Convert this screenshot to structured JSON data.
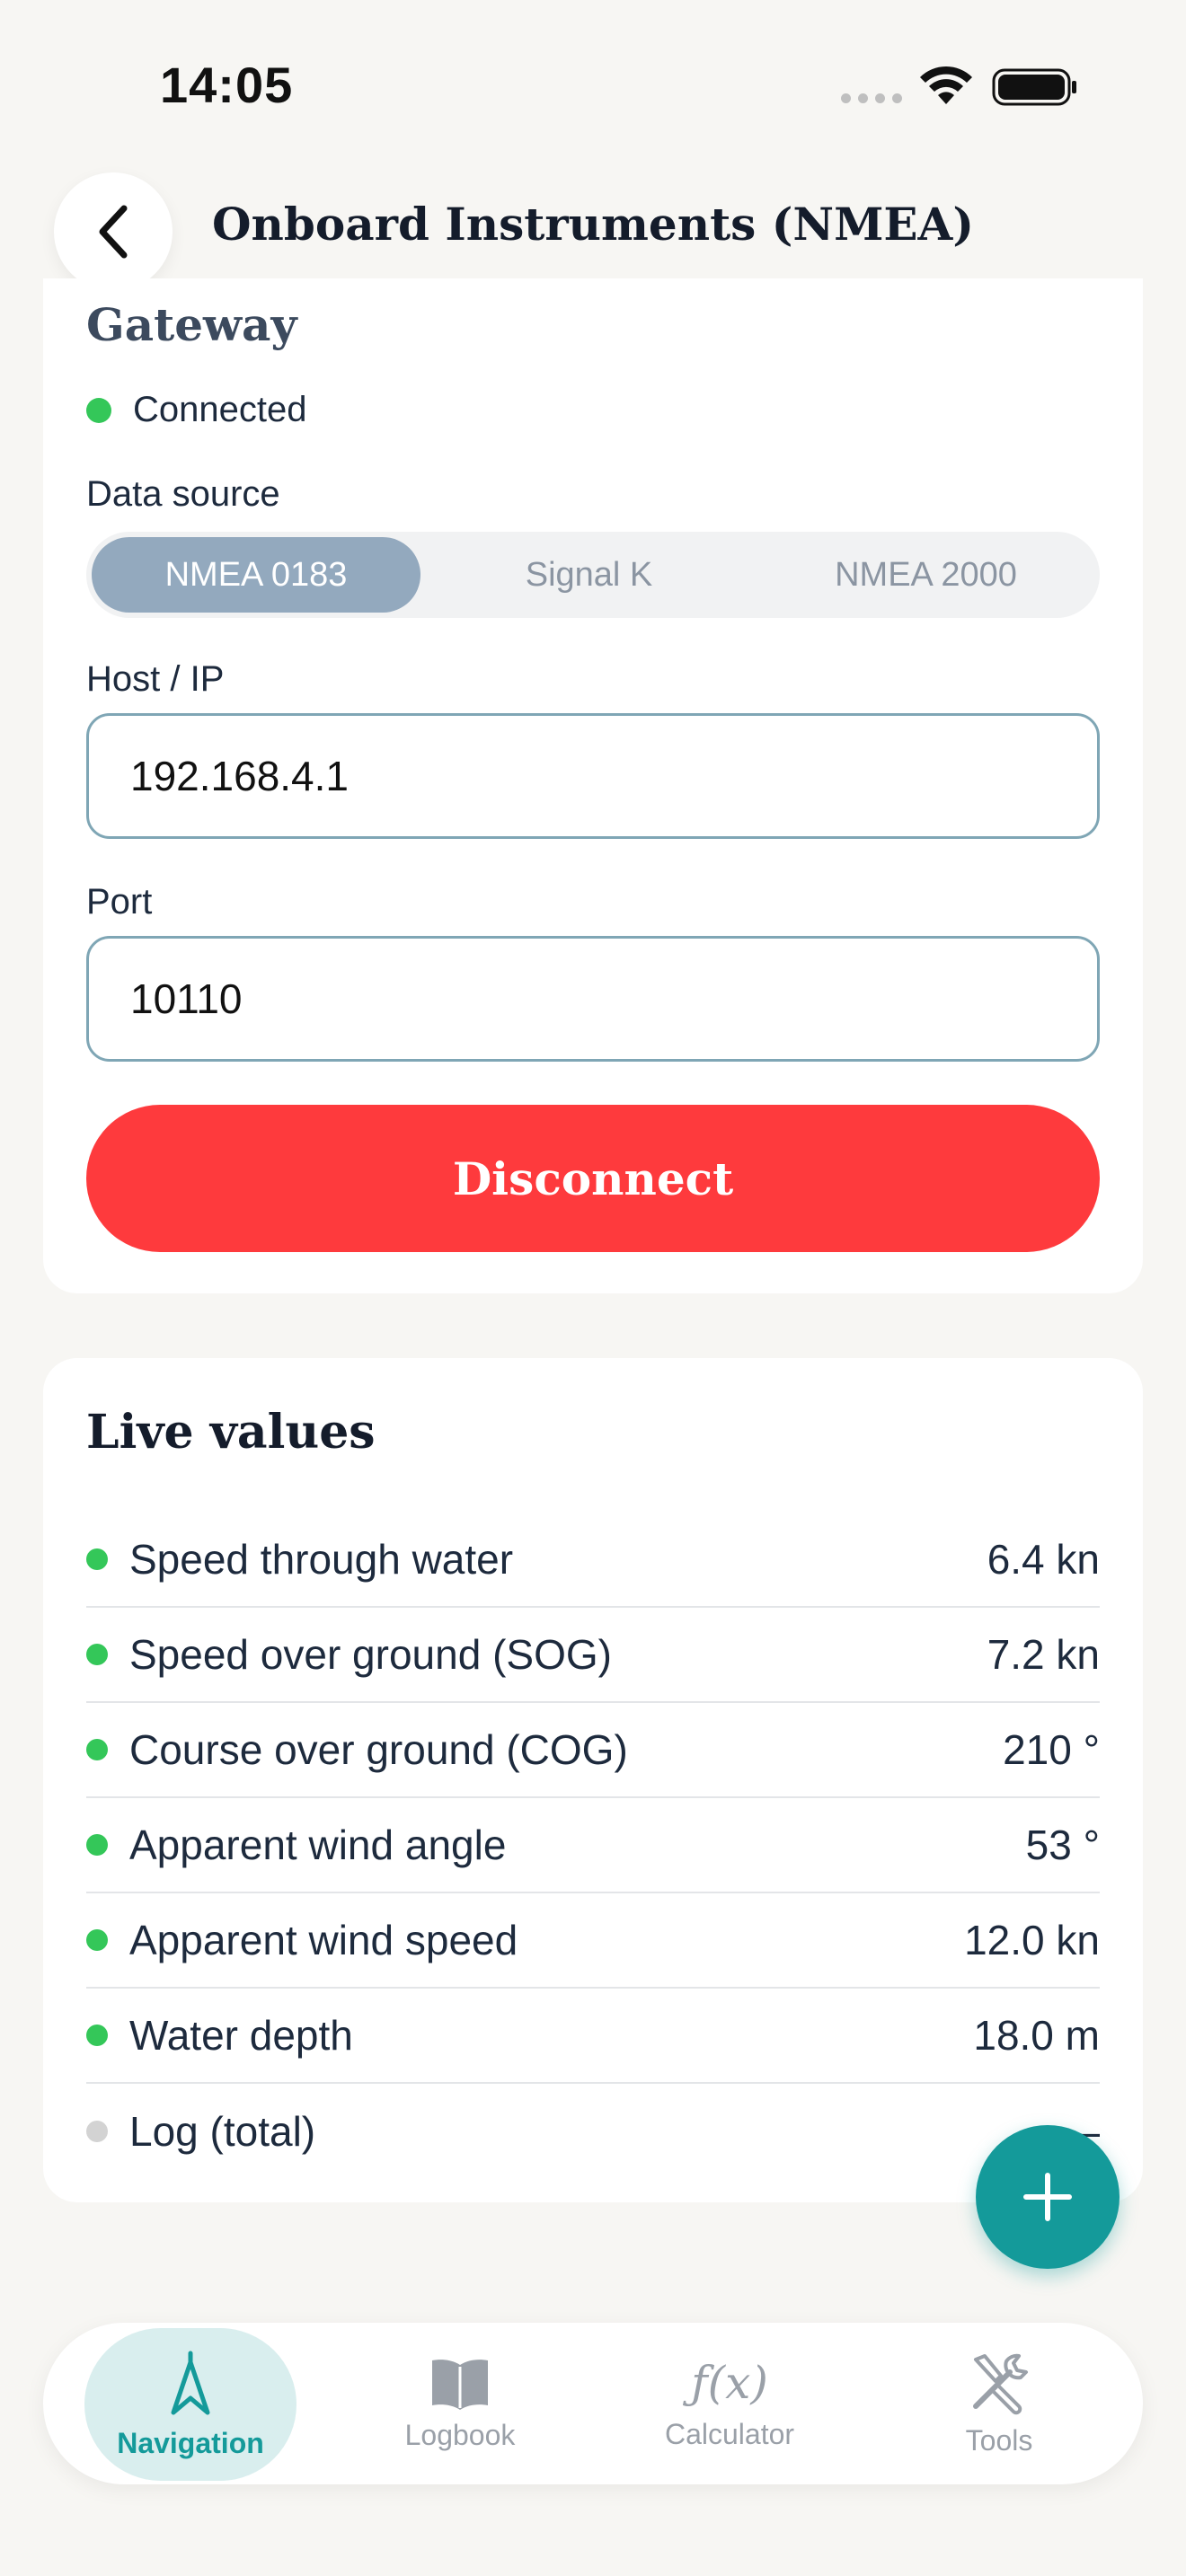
{
  "status_bar": {
    "time": "14:05"
  },
  "header": {
    "title": "Onboard Instruments (NMEA)"
  },
  "gateway": {
    "title": "Gateway",
    "status": "Connected",
    "data_source_label": "Data source",
    "data_sources": [
      "NMEA 0183",
      "Signal K",
      "NMEA 2000"
    ],
    "selected_source": "NMEA 0183",
    "host_label": "Host / IP",
    "host_value": "192.168.4.1",
    "port_label": "Port",
    "port_value": "10110",
    "disconnect_label": "Disconnect"
  },
  "live_values": {
    "title": "Live values",
    "items": [
      {
        "label": "Speed through water",
        "value": "6.4 kn",
        "active": true
      },
      {
        "label": "Speed over ground (SOG)",
        "value": "7.2 kn",
        "active": true
      },
      {
        "label": "Course over ground (COG)",
        "value": "210 °",
        "active": true
      },
      {
        "label": "Apparent wind angle",
        "value": "53 °",
        "active": true
      },
      {
        "label": "Apparent wind speed",
        "value": "12.0 kn",
        "active": true
      },
      {
        "label": "Water depth",
        "value": "18.0 m",
        "active": true
      },
      {
        "label": "Log (total)",
        "value": "—",
        "active": false
      }
    ]
  },
  "bottom_nav": {
    "items": [
      {
        "label": "Navigation",
        "icon": "navigation-arrow-icon",
        "active": true
      },
      {
        "label": "Logbook",
        "icon": "book-icon",
        "active": false
      },
      {
        "label": "Calculator",
        "icon": "function-icon",
        "active": false
      },
      {
        "label": "Tools",
        "icon": "tools-icon",
        "active": false
      }
    ]
  },
  "colors": {
    "accent": "#149a9a",
    "danger": "#fe3a3d",
    "connected": "#34c759",
    "segment_active": "#93a9be"
  }
}
